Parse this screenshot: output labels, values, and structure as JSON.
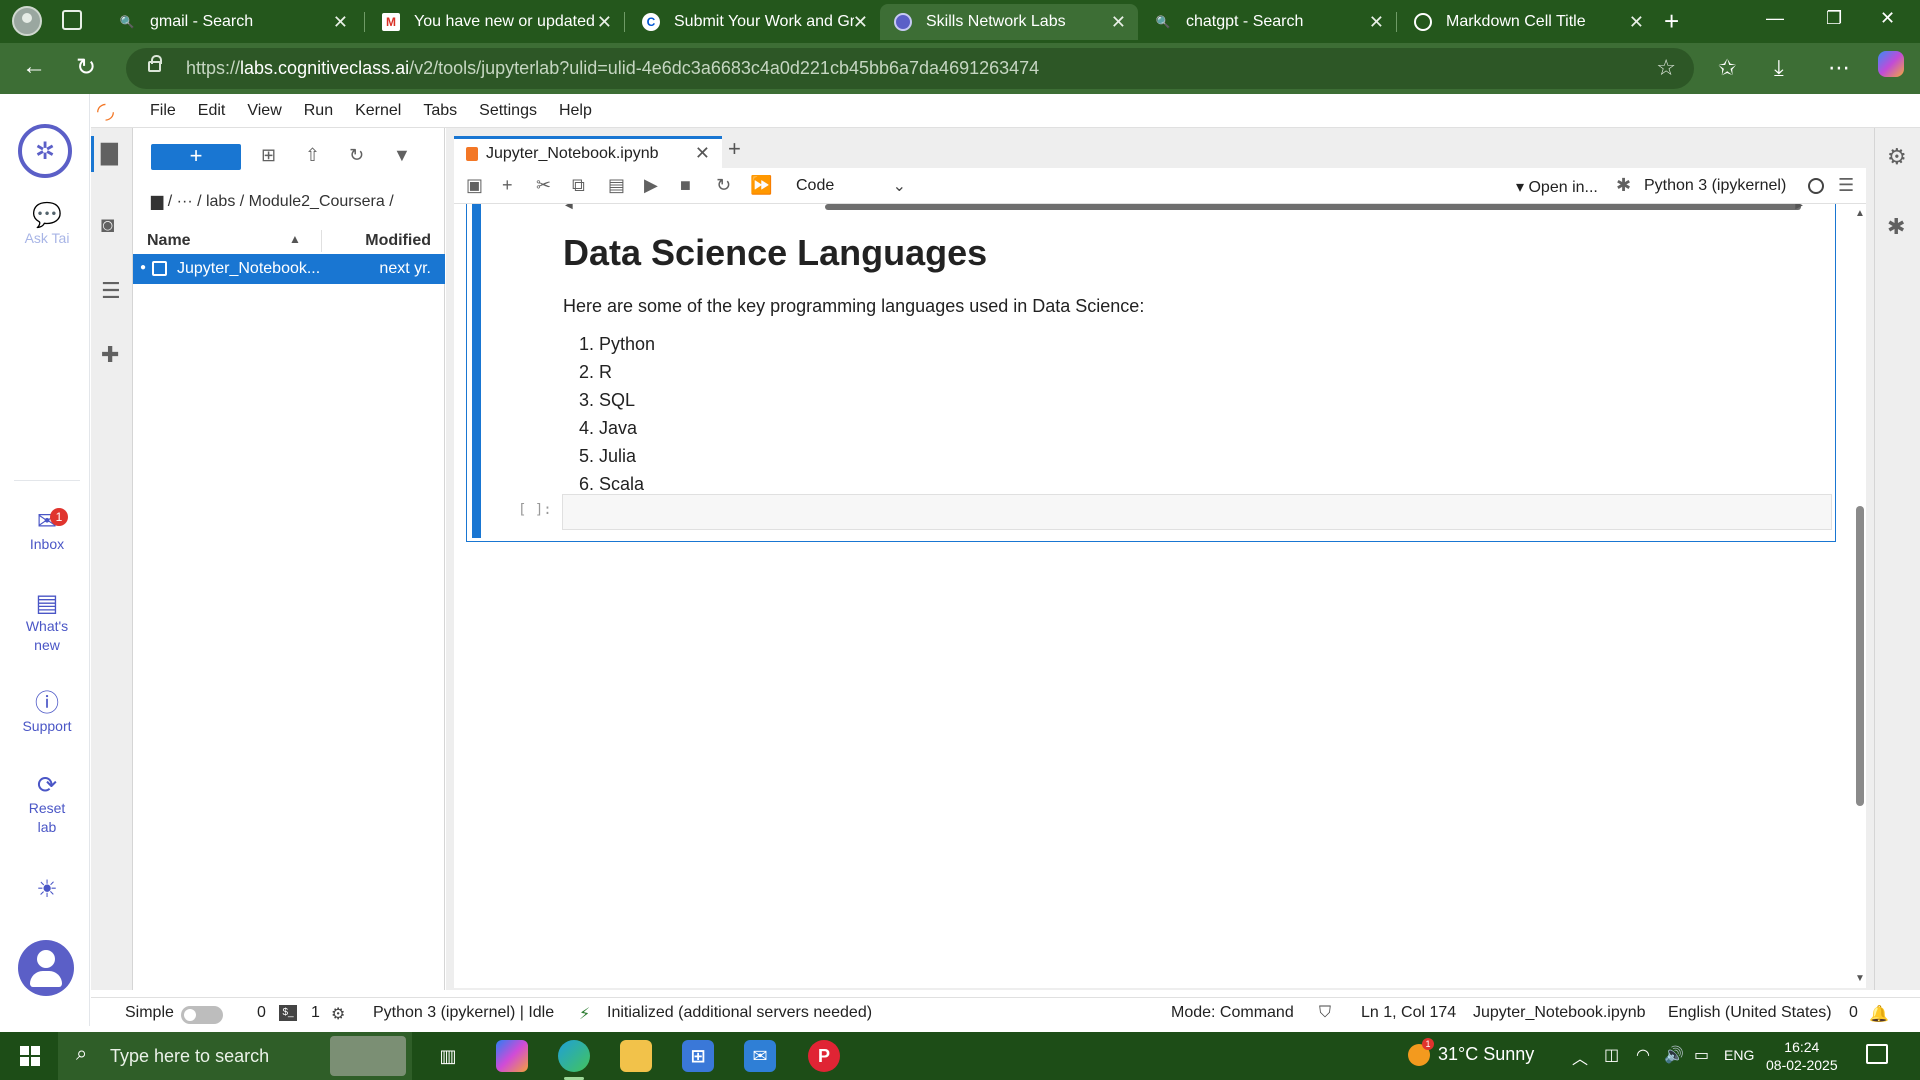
{
  "browser": {
    "tabs": [
      {
        "title": "gmail - Search",
        "favicon": "bing-search-icon",
        "active": false
      },
      {
        "title": "You have new or updated g",
        "favicon": "gmail-icon",
        "active": false
      },
      {
        "title": "Submit Your Work and Grad",
        "favicon": "coursera-icon",
        "active": false
      },
      {
        "title": "Skills Network Labs",
        "favicon": "skills-network-icon",
        "active": true
      },
      {
        "title": "chatgpt - Search",
        "favicon": "bing-search-icon",
        "active": false
      },
      {
        "title": "Markdown Cell Title",
        "favicon": "openai-icon",
        "active": false
      }
    ],
    "url_prefix": "https://",
    "url_domain": "labs.cognitiveclass.ai",
    "url_path": "/v2/tools/jupyterlab?ulid=ulid-4e6dc3a6683c4a0d221cb45bb6a7da4691263474"
  },
  "sn_rail": {
    "ask_tai": "Ask Tai",
    "inbox": "Inbox",
    "inbox_count": "1",
    "whats_new": "What's new",
    "support": "Support",
    "reset_lab": "Reset lab"
  },
  "menu": [
    "File",
    "Edit",
    "View",
    "Run",
    "Kernel",
    "Tabs",
    "Settings",
    "Help"
  ],
  "filebrowser": {
    "new_label": "+",
    "breadcrumb": "/  ···  / labs / Module2_Coursera /",
    "col_name": "Name",
    "col_modified": "Modified",
    "files": [
      {
        "name": "Jupyter_Notebook...",
        "modified": "next yr."
      }
    ]
  },
  "notebook": {
    "tab_title": "Jupyter_Notebook.ipynb",
    "cell_type": "Code",
    "open_in": "Open in...",
    "kernel": "Python 3 (ipykernel)",
    "markdown": {
      "heading": "Data Science Languages",
      "intro": "Here are some of the key programming languages used in Data Science:",
      "languages": [
        "Python",
        "R",
        "SQL",
        "Java",
        "Julia",
        "Scala"
      ]
    },
    "empty_prompt": "[ ]:"
  },
  "statusbar": {
    "mode_simple": "Simple",
    "terminals": "0",
    "kernels": "1",
    "kernel_status": "Python 3 (ipykernel) | Idle",
    "lsp": "Initialized (additional servers needed)",
    "mode": "Mode: Command",
    "cursor": "Ln 1, Col 174",
    "file": "Jupyter_Notebook.ipynb",
    "language": "English (United States)",
    "notifications": "0"
  },
  "taskbar": {
    "search_placeholder": "Type here to search",
    "weather": "31°C  Sunny",
    "weather_badge": "1",
    "lang": "ENG",
    "time": "16:24",
    "date": "08-02-2025"
  },
  "colors": {
    "browser_chrome": "#24571c",
    "jupyter_accent": "#1976d2",
    "jupyter_logo": "#f37726",
    "skills_network": "#5b5fc7"
  }
}
